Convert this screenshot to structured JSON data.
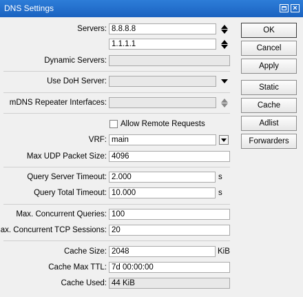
{
  "window": {
    "title": "DNS Settings"
  },
  "form": {
    "servers_label": "Servers:",
    "servers": [
      "8.8.8.8",
      "1.1.1.1"
    ],
    "dynamic_servers_label": "Dynamic Servers:",
    "dynamic_servers_value": "",
    "use_doh_label": "Use DoH Server:",
    "use_doh_value": "",
    "mdns_label": "mDNS Repeater Interfaces:",
    "mdns_value": "",
    "allow_remote_label": "Allow Remote Requests",
    "allow_remote_checked": false,
    "vrf_label": "VRF:",
    "vrf_value": "main",
    "max_udp_label": "Max UDP Packet Size:",
    "max_udp_value": "4096",
    "query_server_timeout_label": "Query Server Timeout:",
    "query_server_timeout_value": "2.000",
    "query_server_timeout_unit": "s",
    "query_total_timeout_label": "Query Total Timeout:",
    "query_total_timeout_value": "10.000",
    "query_total_timeout_unit": "s",
    "max_concurrent_queries_label": "Max. Concurrent Queries:",
    "max_concurrent_queries_value": "100",
    "max_concurrent_tcp_label": "Max. Concurrent TCP Sessions:",
    "max_concurrent_tcp_value": "20",
    "cache_size_label": "Cache Size:",
    "cache_size_value": "2048",
    "cache_size_unit": "KiB",
    "cache_max_ttl_label": "Cache Max TTL:",
    "cache_max_ttl_value": "7d 00:00:00",
    "cache_used_label": "Cache Used:",
    "cache_used_value": "44 KiB"
  },
  "buttons": {
    "ok": "OK",
    "cancel": "Cancel",
    "apply": "Apply",
    "static": "Static",
    "cache": "Cache",
    "adlist": "Adlist",
    "forwarders": "Forwarders"
  }
}
